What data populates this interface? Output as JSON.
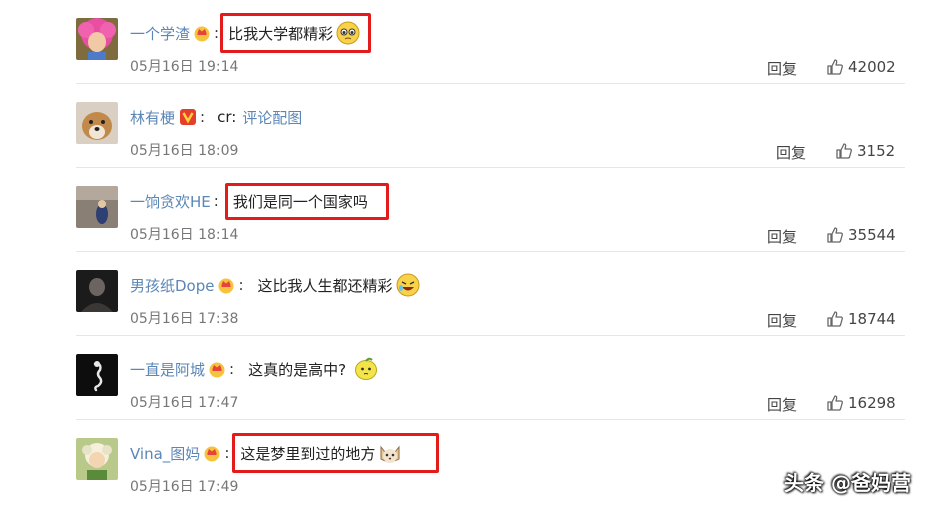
{
  "comments": [
    {
      "username": "一个学渣",
      "text": "比我大学都精彩",
      "date": "05月16日 19:14",
      "reply_label": "回复",
      "likes": "42002"
    },
    {
      "username": "林有梗",
      "text": "cr:",
      "link": "评论配图",
      "date": "05月16日 18:09",
      "reply_label": "回复",
      "likes": "3152"
    },
    {
      "username": "一饷贪欢HE",
      "text": "我们是同一个国家吗",
      "date": "05月16日 18:14",
      "reply_label": "回复",
      "likes": "35544"
    },
    {
      "username": "男孩纸Dope",
      "text": "这比我人生都还精彩",
      "date": "05月16日 17:38",
      "reply_label": "回复",
      "likes": "18744"
    },
    {
      "username": "一直是阿城",
      "text": "这真的是高中?",
      "date": "05月16日 17:47",
      "reply_label": "回复",
      "likes": "16298"
    },
    {
      "username": "Vina_图妈",
      "text": "这是梦里到过的地方",
      "date": "05月16日 17:49"
    }
  ],
  "separator": ":",
  "watermark": "头条 @爸妈营",
  "colors": {
    "username": "#5b86b5",
    "highlight_border": "#e41b1b",
    "time": "#777777"
  }
}
